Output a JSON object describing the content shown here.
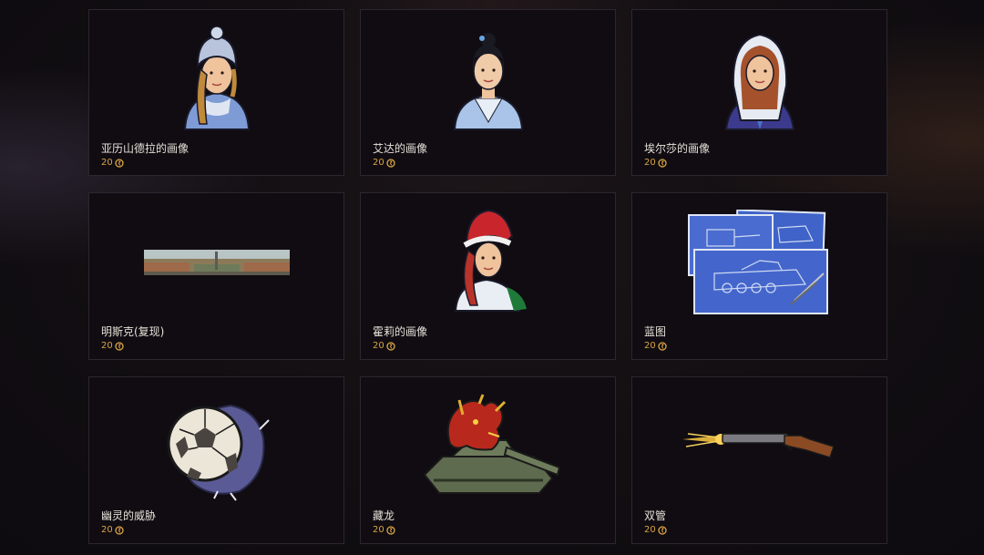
{
  "items": [
    {
      "name": "亚历山德拉的画像",
      "price": "20",
      "icon": "portrait-alexandra-icon"
    },
    {
      "name": "艾达的画像",
      "price": "20",
      "icon": "portrait-ada-icon"
    },
    {
      "name": "埃尔莎的画像",
      "price": "20",
      "icon": "portrait-elsa-icon"
    },
    {
      "name": "明斯克(复现)",
      "price": "20",
      "icon": "minsk-map-icon"
    },
    {
      "name": "霍莉的画像",
      "price": "20",
      "icon": "portrait-holly-icon"
    },
    {
      "name": "蓝图",
      "price": "20",
      "icon": "blueprint-icon"
    },
    {
      "name": "幽灵的威胁",
      "price": "20",
      "icon": "ghost-football-icon"
    },
    {
      "name": "藏龙",
      "price": "20",
      "icon": "dragon-tank-icon"
    },
    {
      "name": "双管",
      "price": "20",
      "icon": "double-barrel-shotgun-icon"
    }
  ],
  "colors": {
    "price": "#d9a441",
    "name": "#e6e1d8",
    "card_bg": "#100c12",
    "card_border": "#2c2630"
  }
}
